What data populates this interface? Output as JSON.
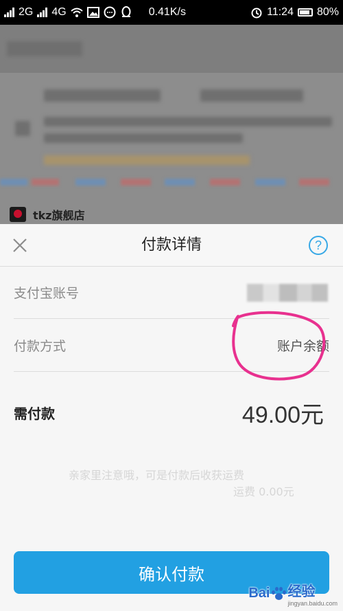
{
  "status_bar": {
    "network_1": "2G",
    "network_2": "4G",
    "speed": "0.41K/s",
    "time": "11:24",
    "battery": "80%"
  },
  "background": {
    "shop_name": "tkz旗舰店"
  },
  "sheet": {
    "title": "付款详情",
    "help_glyph": "?",
    "rows": [
      {
        "label": "支付宝账号",
        "value": ""
      },
      {
        "label": "付款方式",
        "value": "账户余额"
      }
    ],
    "amount_due": {
      "label": "需付款",
      "value": "49.00元"
    },
    "confirm_label": "确认付款"
  },
  "faded_text": {
    "line_1": "亲家里注意哦，可是付款后收获运费",
    "line_2": "运费 0.00元"
  },
  "watermark": {
    "brand": "Bai",
    "brand_suffix": "经验",
    "url": "jingyan.baidu.com"
  },
  "colors": {
    "accent": "#22a0e2",
    "annotation": "#e8318f"
  },
  "icons": [
    "signal-icon",
    "wifi-icon",
    "image-icon",
    "chat-icon",
    "qq-icon",
    "alarm-icon",
    "battery-icon",
    "close-icon",
    "help-icon",
    "paw-icon"
  ]
}
